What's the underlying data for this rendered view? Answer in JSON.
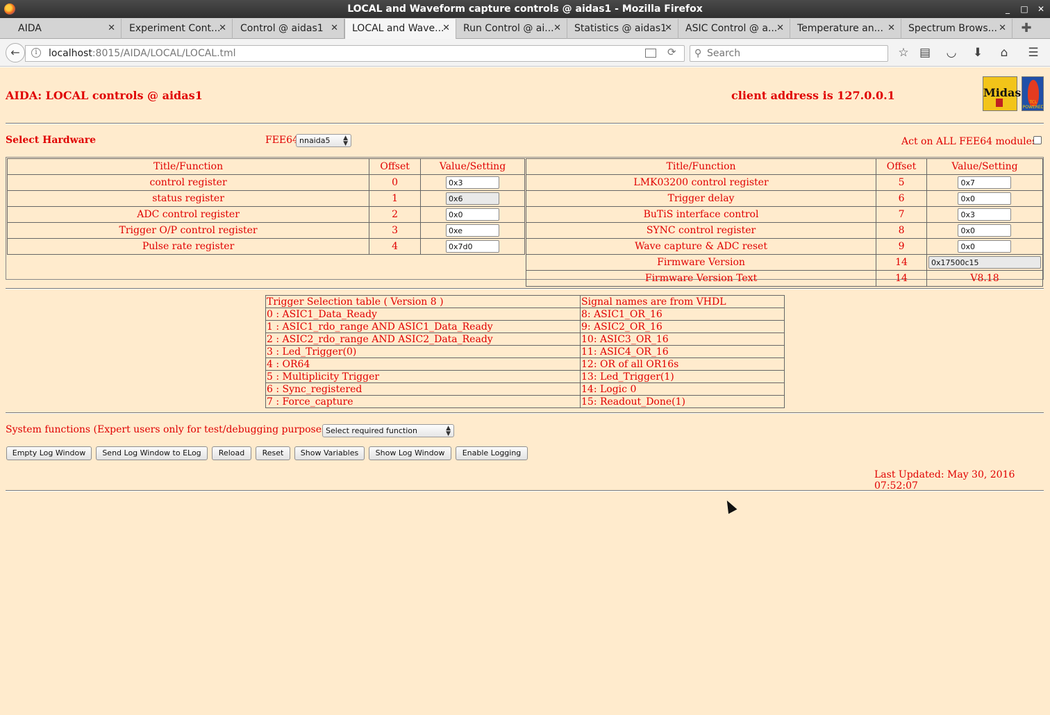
{
  "window": {
    "title": "LOCAL and Waveform capture controls @ aidas1 - Mozilla Firefox",
    "controls": {
      "minimize": "_",
      "maximize": "□",
      "close": "✕"
    }
  },
  "tabs": [
    {
      "label": "AIDA",
      "active": false
    },
    {
      "label": "Experiment Cont...",
      "active": false
    },
    {
      "label": "Control @ aidas1",
      "active": false
    },
    {
      "label": "LOCAL and Wave...",
      "active": true
    },
    {
      "label": "Run Control @ ai...",
      "active": false
    },
    {
      "label": "Statistics @ aidas1",
      "active": false
    },
    {
      "label": "ASIC Control @ a...",
      "active": false
    },
    {
      "label": "Temperature an...",
      "active": false
    },
    {
      "label": "Spectrum Brows...",
      "active": false
    }
  ],
  "navbar": {
    "url_host": "localhost",
    "url_rest": ":8015/AIDA/LOCAL/LOCAL.tml",
    "search_placeholder": "Search",
    "icons": [
      "back-icon",
      "info-icon",
      "reader-view-icon",
      "reload-icon",
      "search-icon",
      "bookmark-star-icon",
      "reading-list-icon",
      "pocket-icon",
      "download-icon",
      "home-icon",
      "menu-icon"
    ]
  },
  "header": {
    "title": "AIDA: LOCAL controls @ aidas1",
    "client_address": "client address is 127.0.0.1",
    "logo_midas": "Midas",
    "logo_tcl": "TCL POWERED"
  },
  "hardware": {
    "label": "Select Hardware",
    "fee_label": "FEE64",
    "fee_selected": "nnaida5",
    "act_all_label": "Act on ALL FEE64 modules?",
    "act_all_checked": false
  },
  "register_headers": {
    "title": "Title/Function",
    "offset": "Offset",
    "value": "Value/Setting"
  },
  "registers_left": [
    {
      "title": "control register",
      "offset": "0",
      "value": "0x3",
      "readonly": false
    },
    {
      "title": "status register",
      "offset": "1",
      "value": "0x6",
      "readonly": true
    },
    {
      "title": "ADC control register",
      "offset": "2",
      "value": "0x0",
      "readonly": false
    },
    {
      "title": "Trigger O/P control register",
      "offset": "3",
      "value": "0xe",
      "readonly": false
    },
    {
      "title": "Pulse rate register",
      "offset": "4",
      "value": "0x7d0",
      "readonly": false
    }
  ],
  "registers_right": [
    {
      "title": "LMK03200 control register",
      "offset": "5",
      "value": "0x7",
      "readonly": false
    },
    {
      "title": "Trigger delay",
      "offset": "6",
      "value": "0x0",
      "readonly": false
    },
    {
      "title": "BuTiS interface control",
      "offset": "7",
      "value": "0x3",
      "readonly": false
    },
    {
      "title": "SYNC control register",
      "offset": "8",
      "value": "0x0",
      "readonly": false
    },
    {
      "title": "Wave capture & ADC reset",
      "offset": "9",
      "value": "0x0",
      "readonly": false
    }
  ],
  "firmware": {
    "version_title": "Firmware Version",
    "version_offset": "14",
    "version_value": "0x17500c15",
    "text_title": "Firmware Version Text",
    "text_offset": "14",
    "text_value": "V8.18"
  },
  "trigger_table": {
    "header_left": "Trigger Selection table ( Version 8 )",
    "header_right": "Signal names are from VHDL",
    "rows": [
      [
        "0 : ASIC1_Data_Ready",
        "8: ASIC1_OR_16"
      ],
      [
        "1 : ASIC1_rdo_range AND ASIC1_Data_Ready",
        "9: ASIC2_OR_16"
      ],
      [
        "2 : ASIC2_rdo_range AND ASIC2_Data_Ready",
        "10: ASIC3_OR_16"
      ],
      [
        "3 : Led_Trigger(0)",
        "11: ASIC4_OR_16"
      ],
      [
        "4 : OR64",
        "12: OR of all OR16s"
      ],
      [
        "5 : Multiplicity Trigger",
        "13: Led_Trigger(1)"
      ],
      [
        "6 : Sync_registered",
        "14: Logic 0"
      ],
      [
        "7 : Force_capture",
        "15: Readout_Done(1)"
      ]
    ]
  },
  "system": {
    "label": "System functions (Expert users only for test/debugging purposes!!!)",
    "select_value": "Select required function"
  },
  "buttons": {
    "empty_log": "Empty Log Window",
    "send_log": "Send Log Window to ELog",
    "reload": "Reload",
    "reset": "Reset",
    "show_vars": "Show Variables",
    "show_log": "Show Log Window",
    "enable_logging": "Enable Logging"
  },
  "footer": {
    "last_updated": "Last Updated: May 30, 2016 07:52:07"
  },
  "colors": {
    "page_bg": "#ffebcd",
    "text_red": "#e00000"
  }
}
